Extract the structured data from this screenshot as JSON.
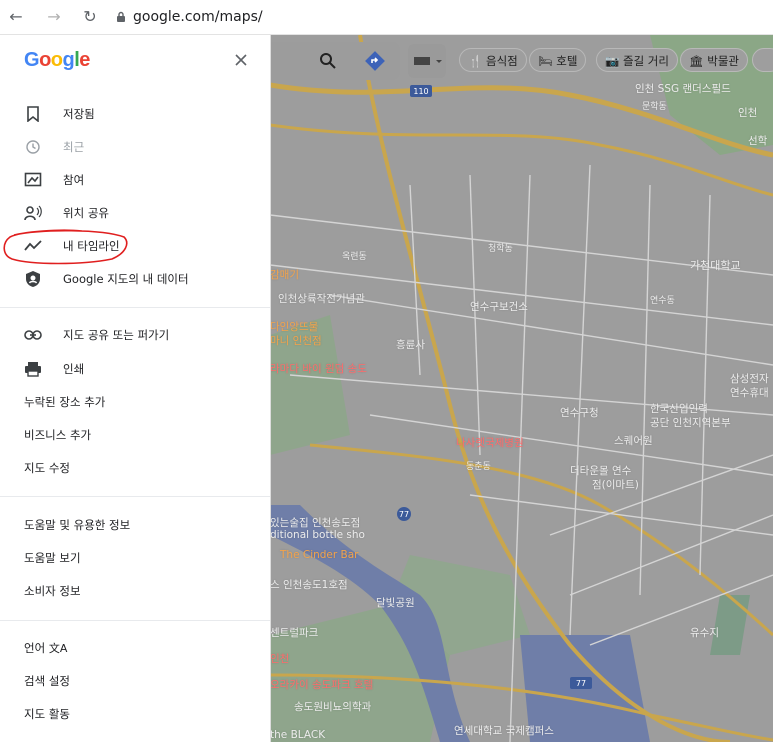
{
  "browser": {
    "url": "google.com/maps/"
  },
  "brand": {
    "logo_text": "Google",
    "logo_letters": [
      "G",
      "o",
      "o",
      "g",
      "l",
      "e"
    ],
    "logo_colors": [
      "#4285F4",
      "#EA4335",
      "#FBBC05",
      "#4285F4",
      "#34A853",
      "#EA4335"
    ]
  },
  "menu": {
    "saved": "저장됨",
    "recent": "최근",
    "contribute": "참여",
    "location_sharing": "위치 공유",
    "timeline": "내 타임라인",
    "my_data": "Google 지도의 내 데이터",
    "share_embed": "지도 공유 또는 퍼가기",
    "print": "인쇄",
    "add_missing_place": "누락된 장소 추가",
    "add_business": "비즈니스 추가",
    "edit_map": "지도 수정",
    "tips": "도움말 및 유용한 정보",
    "help": "도움말 보기",
    "consumer_info": "소비자 정보",
    "language": "언어",
    "search_settings": "검색 설정",
    "maps_activity": "지도 활동"
  },
  "chips": [
    "음식점",
    "호텔",
    "즐길 거리",
    "박물관"
  ],
  "map_labels": {
    "route_110": "110",
    "route_77a": "77",
    "route_77b": "77",
    "ssg": "인천 SSG 랜더스필드",
    "munhak": "문학동",
    "incheon_park": "인천",
    "seonhak": "선학",
    "gachon": "가천대학교",
    "okryeon": "옥련동",
    "cheonghak": "청학동",
    "yeonsu_health": "연수구보건소",
    "yeonsu_dong": "연수동",
    "incheon_museum": "인천상륙작전기념관",
    "dahwa_incheon": "다인앙뜨물",
    "mama": "마니 인천점",
    "heungryunsa": "흥륜사",
    "ramada": "라마다 바이 윈덤 송도",
    "yeonsu_office": "연수구청",
    "samsung": "삼성전자",
    "samsung2": "연수휴대",
    "nazareth": "나사렛국제병원",
    "dongchun": "동춘동",
    "hrd": "한국산업인력",
    "hrd2": "공단 인천지역본부",
    "square1": "스퀘어원",
    "emart": "더타운몰 연수",
    "emart2": "점(이마트)",
    "bottle": "있는술집 인천송도점",
    "bottle2": "ditional bottle sho",
    "cinder": "The Cinder Bar",
    "songdo1": "스 인천송도1호점",
    "dalbit": "달빛공원",
    "central": "센트럴파크",
    "incheon2": "인천",
    "orakai": "오라카이 송도파크 호텔",
    "songdowon": "송도원비뇨의학과",
    "black": "the BLACK",
    "yonsei": "연세대학교 국제캠퍼스",
    "yusuji": "유수지",
    "gamtae": "감매기"
  }
}
